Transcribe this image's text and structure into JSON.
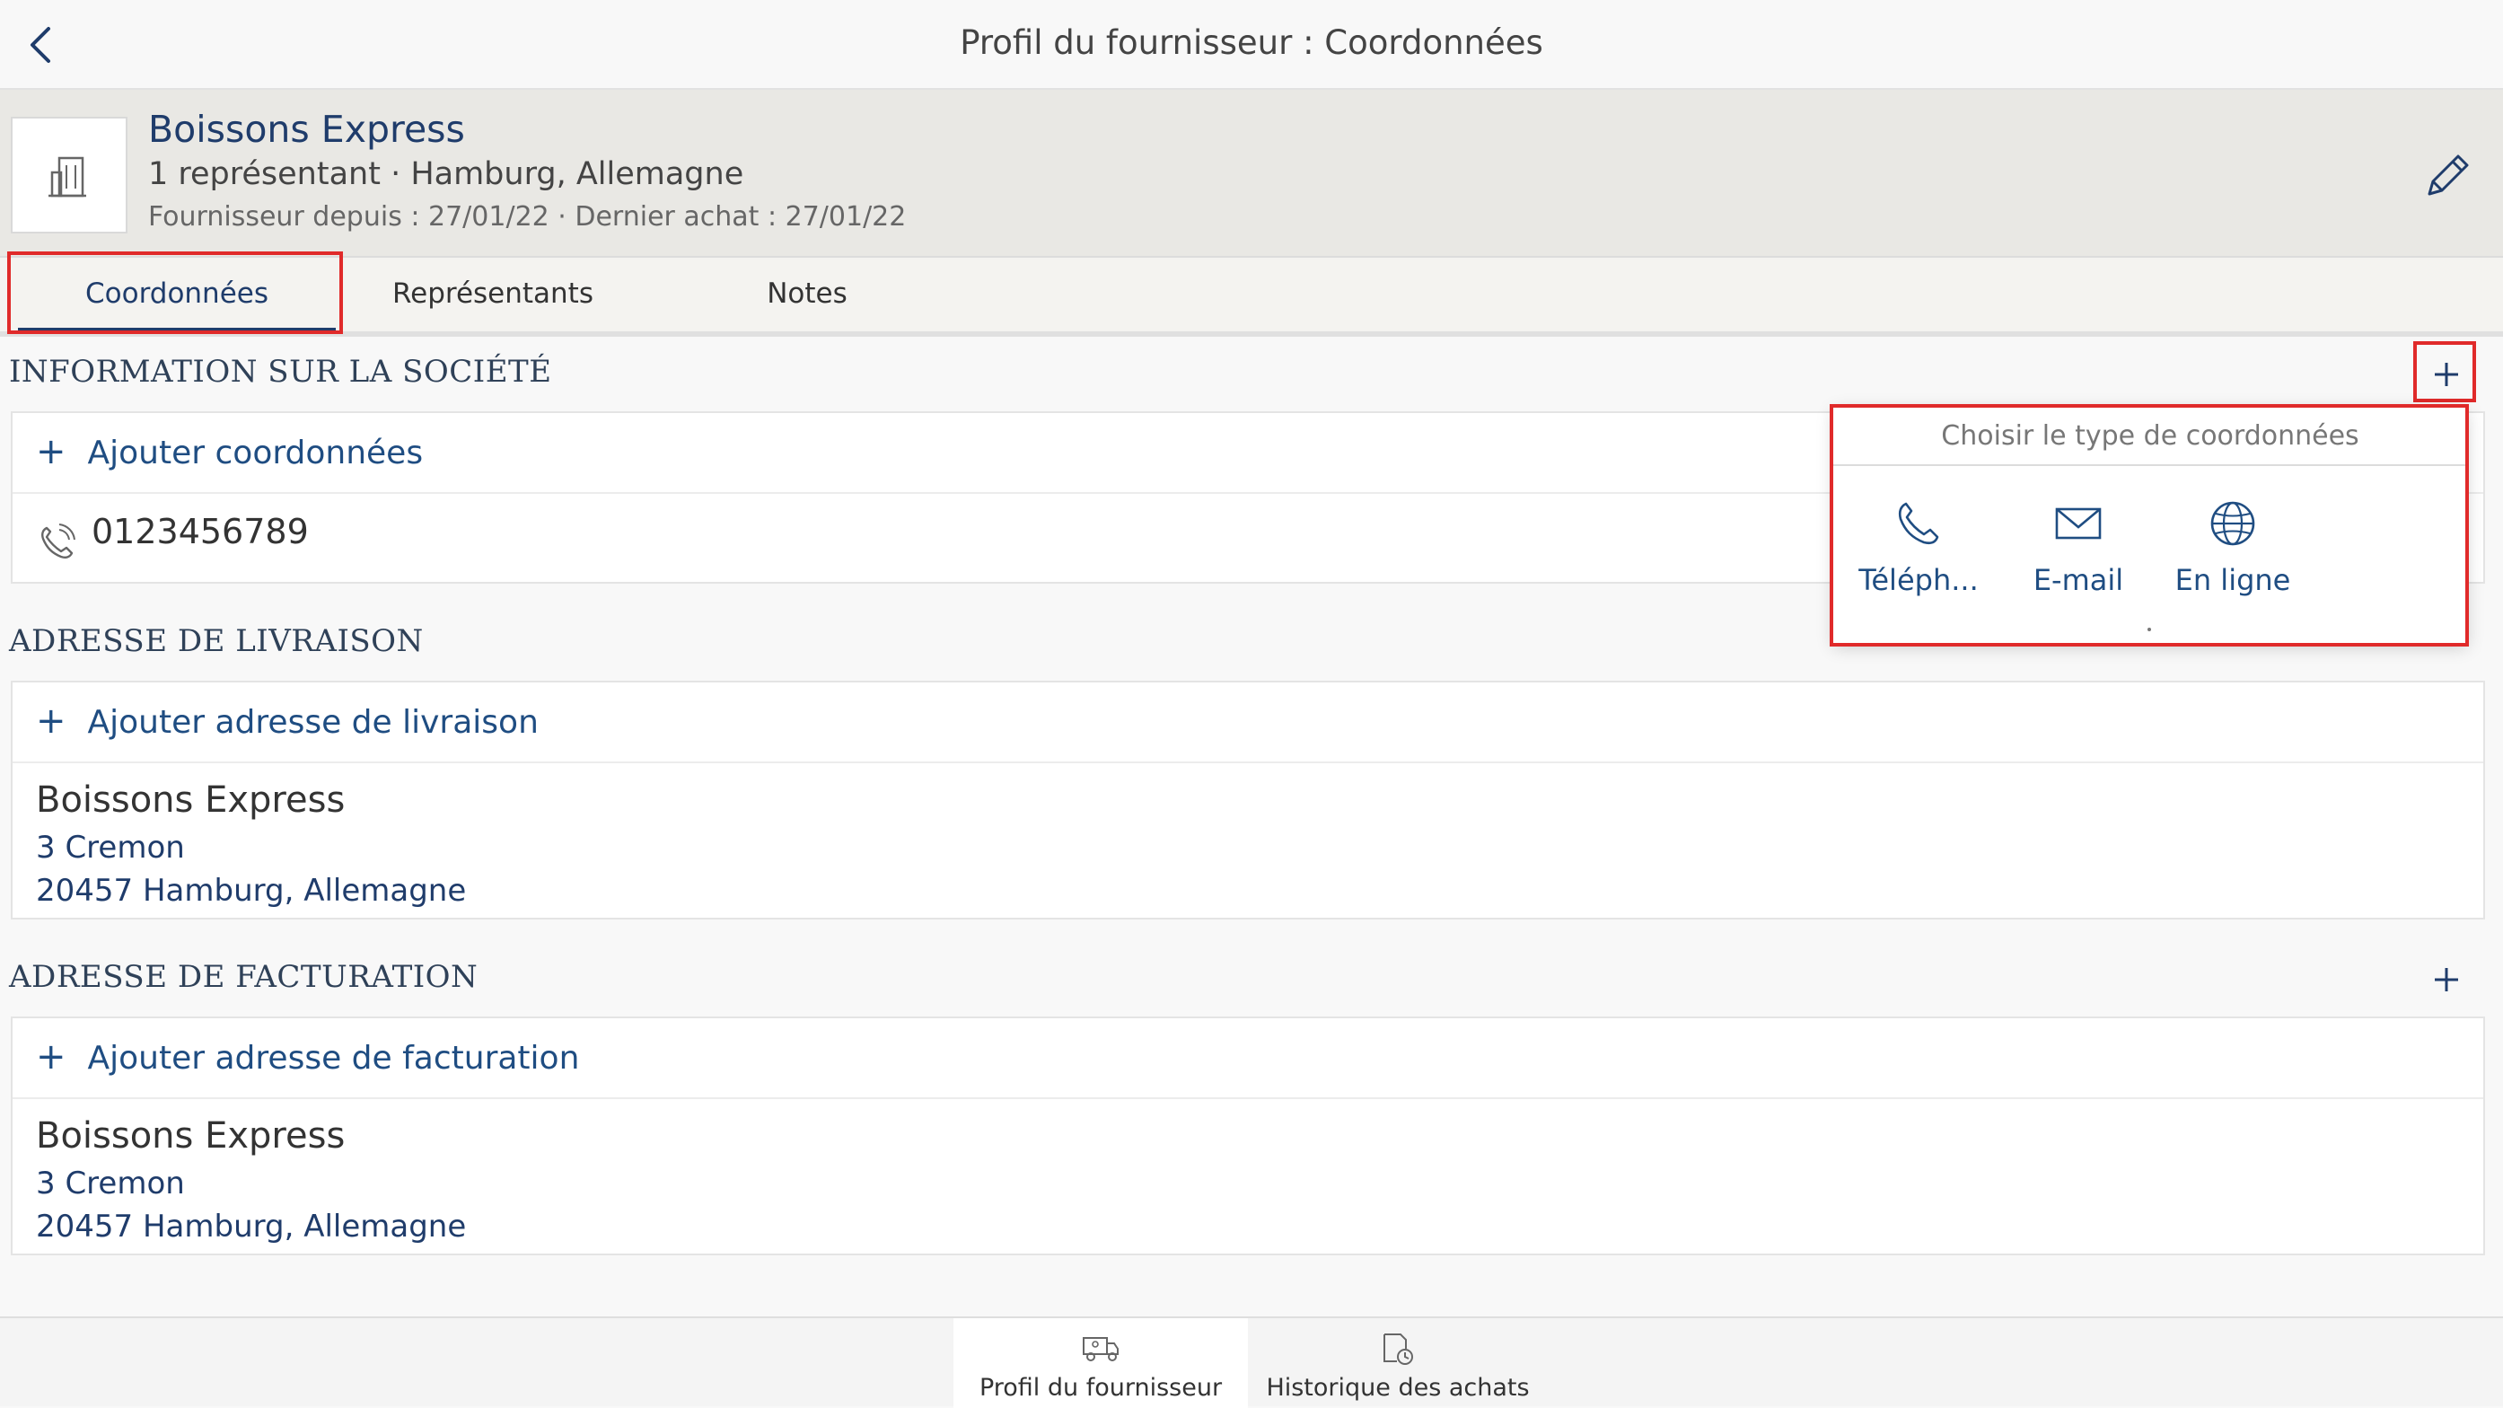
{
  "nav": {
    "title": "Profil du fournisseur : Coordonnées"
  },
  "supplier": {
    "name": "Boissons Express",
    "meta": "1 représentant · Hamburg, Allemagne",
    "dates": "Fournisseur depuis : 27/01/22 · Dernier achat : 27/01/22"
  },
  "tabs": [
    {
      "label": "Coordonnées",
      "active": true
    },
    {
      "label": "Représentants",
      "active": false
    },
    {
      "label": "Notes",
      "active": false
    }
  ],
  "company_info": {
    "title": "INFORMATION SUR LA SOCIÉTÉ",
    "add_label": "Ajouter coordonnées",
    "phone": "0123456789"
  },
  "popover": {
    "header": "Choisir le type de coordonnées",
    "options": [
      {
        "label": "Téléph...",
        "icon": "phone-icon"
      },
      {
        "label": "E-mail",
        "icon": "mail-icon"
      },
      {
        "label": "En ligne",
        "icon": "globe-icon"
      }
    ]
  },
  "delivery": {
    "title": "ADRESSE DE LIVRAISON",
    "add_label": "Ajouter adresse de livraison",
    "name": "Boissons Express",
    "street": "3 Cremon",
    "city": "20457 Hamburg, Allemagne"
  },
  "billing": {
    "title": "ADRESSE DE FACTURATION",
    "add_label": "Ajouter adresse de facturation",
    "name": "Boissons Express",
    "street": "3 Cremon",
    "city": "20457 Hamburg, Allemagne"
  },
  "bottom_tabs": [
    {
      "label": "Profil du fournisseur",
      "active": true
    },
    {
      "label": "Historique des achats",
      "active": false
    }
  ],
  "colors": {
    "accent": "#1f3c6b",
    "link": "#1f4d82",
    "highlight": "#e02a2a",
    "header_bg": "#e9e8e4"
  }
}
